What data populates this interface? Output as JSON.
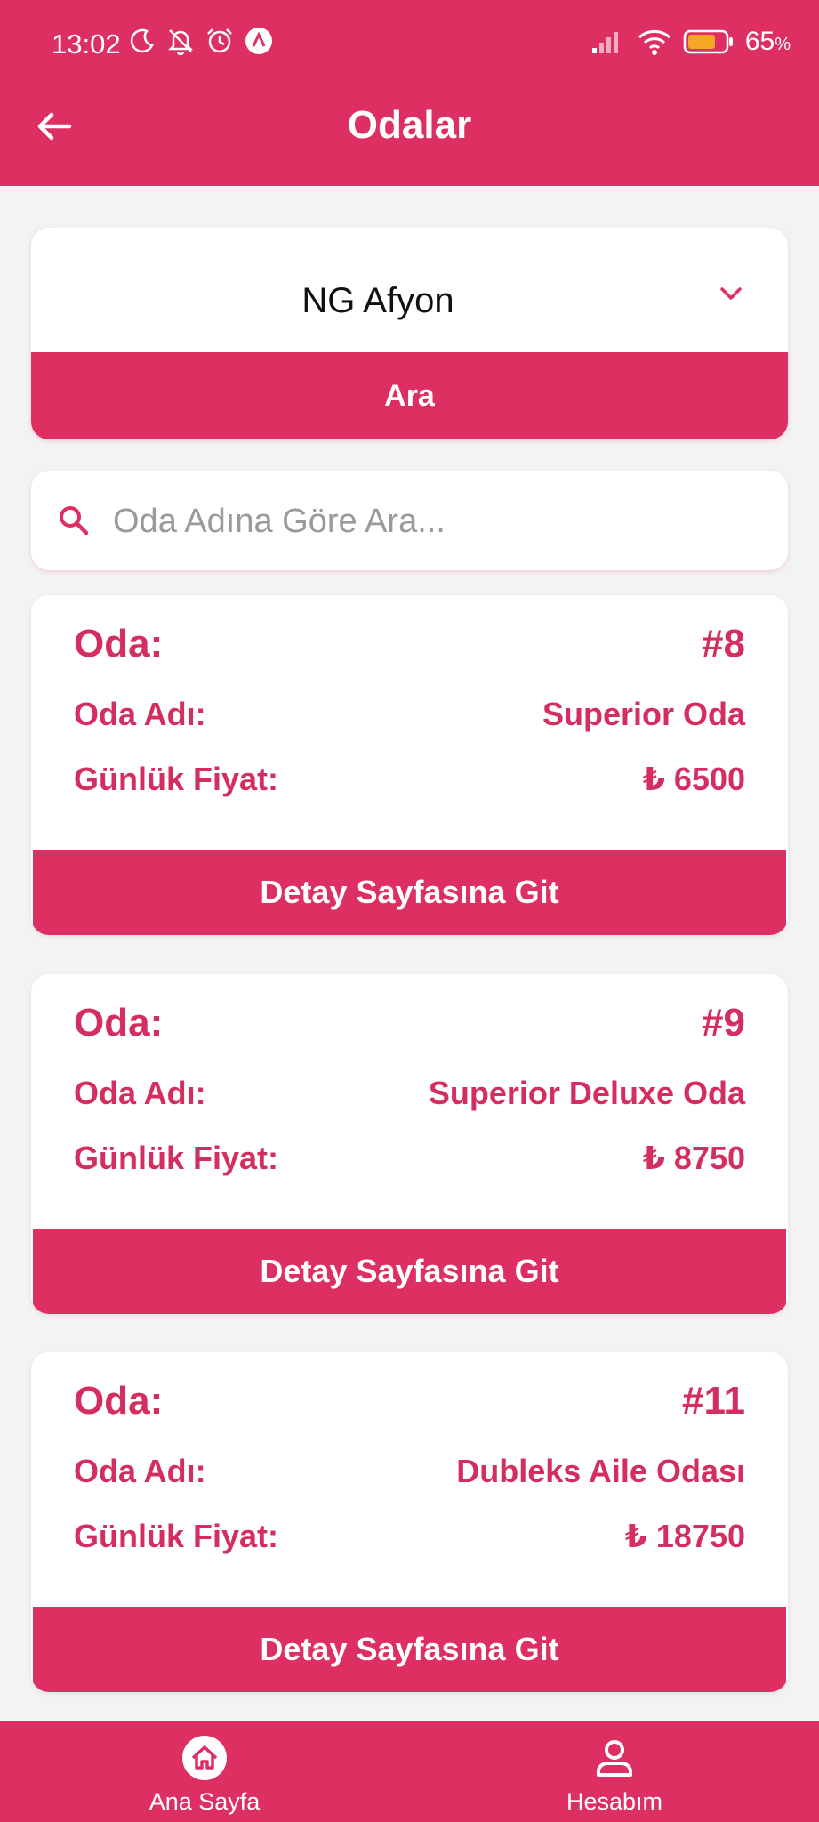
{
  "status_bar": {
    "time": "13:02",
    "battery": "65",
    "battery_unit": "%"
  },
  "header": {
    "title": "Odalar"
  },
  "hotel_select": {
    "value": "NG Afyon",
    "search_label": "Ara"
  },
  "room_search": {
    "placeholder": "Oda Adına Göre Ara..."
  },
  "rooms": [
    {
      "room_label": "Oda:",
      "number": "#8",
      "name_label": "Oda Adı:",
      "name": "Superior Oda",
      "price_label": "Günlük Fiyat:",
      "price": "₺ 6500",
      "button": "Detay Sayfasına Git"
    },
    {
      "room_label": "Oda:",
      "number": "#9",
      "name_label": "Oda Adı:",
      "name": "Superior Deluxe Oda",
      "price_label": "Günlük Fiyat:",
      "price": "₺ 8750",
      "button": "Detay Sayfasına Git"
    },
    {
      "room_label": "Oda:",
      "number": "#11",
      "name_label": "Oda Adı:",
      "name": "Dubleks Aile Odası",
      "price_label": "Günlük Fiyat:",
      "price": "₺ 18750",
      "button": "Detay Sayfasına Git"
    }
  ],
  "bottom_nav": {
    "home": "Ana Sayfa",
    "account": "Hesabım"
  },
  "colors": {
    "primary": "#de2f62",
    "text_accent": "#d42e60",
    "background": "#f3f3f4"
  },
  "icons": [
    "back-arrow-icon",
    "chevron-down-icon",
    "search-icon",
    "home-icon",
    "user-icon",
    "moon-icon",
    "bell-off-icon",
    "alarm-icon",
    "signal-icon",
    "wifi-icon",
    "battery-icon"
  ]
}
